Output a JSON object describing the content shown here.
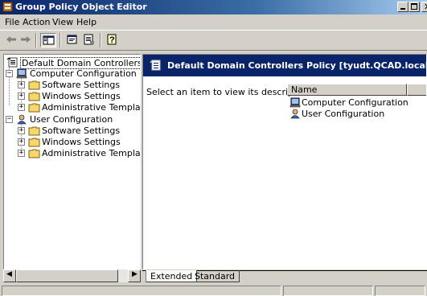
{
  "window": {
    "title": "Group Policy Object Editor"
  },
  "menu": [
    {
      "label": "File"
    },
    {
      "label": "Action"
    },
    {
      "label": "View"
    },
    {
      "label": "Help"
    }
  ],
  "toolbar": {
    "buttons": [
      "back-arrow-icon",
      "forward-arrow-icon",
      "show-hide-tree-icon",
      "properties-icon",
      "export-list-icon",
      "help-icon"
    ]
  },
  "tree": {
    "root": "Default Domain Controllers Policy [t",
    "computer": "Computer Configuration",
    "computer_children": [
      "Software Settings",
      "Windows Settings",
      "Administrative Templates"
    ],
    "user": "User Configuration",
    "user_children": [
      "Software Settings",
      "Windows Settings",
      "Administrative Templates"
    ]
  },
  "right": {
    "header": "Default Domain Controllers Policy [tyudt.QCAD.local] Policy",
    "description": "Select an item to view its description.",
    "column_name": "Name",
    "items": [
      "Computer Configuration",
      "User Configuration"
    ]
  },
  "tabs": [
    {
      "label": "Extended"
    },
    {
      "label": "Standard"
    }
  ],
  "colors": {
    "title_bar": "#0a246a",
    "header_band": "#0a246a",
    "face": "#d4d0c8"
  }
}
